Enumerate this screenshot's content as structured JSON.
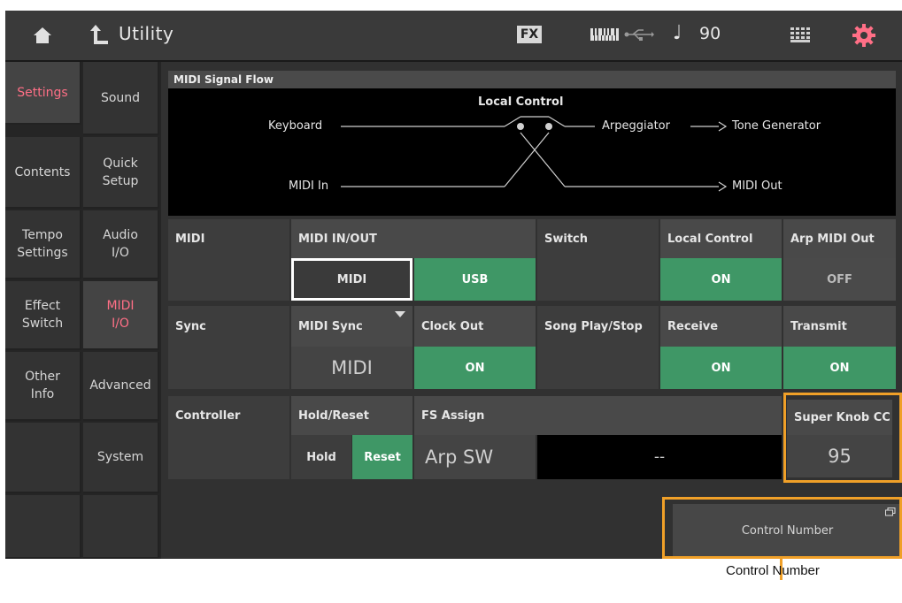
{
  "topbar": {
    "title": "Utility",
    "fx_label": "FX",
    "note_symbol": "♩",
    "tempo": "90"
  },
  "nav": {
    "main": [
      {
        "label": "Settings"
      },
      {
        "label": "Contents"
      },
      {
        "label": "Tempo\nSettings"
      },
      {
        "label": "Effect\nSwitch"
      },
      {
        "label": "Other\nInfo"
      }
    ],
    "sub": [
      {
        "label": "Sound"
      },
      {
        "label": "Quick\nSetup"
      },
      {
        "label": "Audio\nI/O"
      },
      {
        "label": "MIDI\nI/O"
      },
      {
        "label": "Advanced"
      },
      {
        "label": "System"
      }
    ]
  },
  "flow": {
    "title": "MIDI Signal Flow",
    "local_control": "Local Control",
    "keyboard": "Keyboard",
    "arpeggiator": "Arpeggiator",
    "tone_generator": "Tone Generator",
    "midi_in": "MIDI In",
    "midi_out": "MIDI Out"
  },
  "midi": {
    "section_label": "MIDI",
    "in_out_header": "MIDI IN/OUT",
    "midi_button": "MIDI",
    "usb_button": "USB",
    "switch_label": "Switch",
    "local_control_header": "Local Control",
    "local_control_value": "ON",
    "arp_midi_out_header": "Arp MIDI Out",
    "arp_midi_out_value": "OFF"
  },
  "sync": {
    "section_label": "Sync",
    "midi_sync_header": "MIDI Sync",
    "midi_sync_value": "MIDI",
    "clock_out_header": "Clock Out",
    "clock_out_value": "ON",
    "song_label": "Song Play/Stop",
    "receive_header": "Receive",
    "receive_value": "ON",
    "transmit_header": "Transmit",
    "transmit_value": "ON"
  },
  "controller": {
    "section_label": "Controller",
    "hold_reset_header": "Hold/Reset",
    "hold_button": "Hold",
    "reset_button": "Reset",
    "fs_assign_header": "FS Assign",
    "fs_assign_value": "Arp SW",
    "fs_assign_cc": "--",
    "super_knob_header": "Super Knob CC",
    "super_knob_value": "95",
    "control_number_button": "Control Number"
  },
  "caption": "Control Number",
  "colors": {
    "on_green": "#3f9766",
    "active_pink": "#ff6f86",
    "highlight_orange": "#f0a028"
  }
}
